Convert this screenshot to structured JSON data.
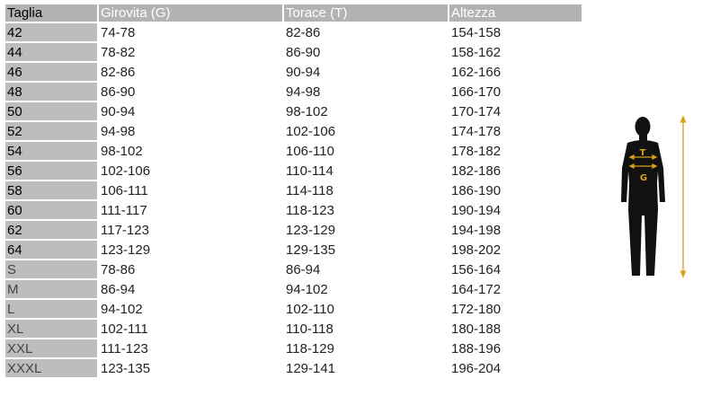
{
  "table": {
    "headers": [
      "Taglia",
      "Girovita (G)",
      "Torace (T)",
      "Altezza"
    ],
    "rows": [
      [
        "42",
        "74-78",
        "82-86",
        "154-158"
      ],
      [
        "44",
        "78-82",
        "86-90",
        "158-162"
      ],
      [
        "46",
        "82-86",
        "90-94",
        "162-166"
      ],
      [
        "48",
        "86-90",
        "94-98",
        "166-170"
      ],
      [
        "50",
        "90-94",
        "98-102",
        "170-174"
      ],
      [
        "52",
        "94-98",
        "102-106",
        "174-178"
      ],
      [
        "54",
        "98-102",
        "106-110",
        "178-182"
      ],
      [
        "56",
        "102-106",
        "110-114",
        "182-186"
      ],
      [
        "58",
        "106-111",
        "114-118",
        "186-190"
      ],
      [
        "60",
        "111-117",
        "118-123",
        "190-194"
      ],
      [
        "62",
        "117-123",
        "123-129",
        "194-198"
      ],
      [
        "64",
        "123-129",
        "129-135",
        "198-202"
      ],
      [
        "S",
        "78-86",
        "86-94",
        "156-164"
      ],
      [
        "M",
        "86-94",
        "94-102",
        "164-172"
      ],
      [
        "L",
        "94-102",
        "102-110",
        "172-180"
      ],
      [
        "XL",
        "102-111",
        "110-118",
        "180-188"
      ],
      [
        "XXL",
        "111-123",
        "118-129",
        "188-196"
      ],
      [
        "XXXL",
        "123-135",
        "129-141",
        "196-204"
      ]
    ]
  },
  "figure": {
    "chest_label": "T",
    "waist_label": "G",
    "marker_color": "#d9a21b",
    "silhouette_color": "#111111"
  }
}
